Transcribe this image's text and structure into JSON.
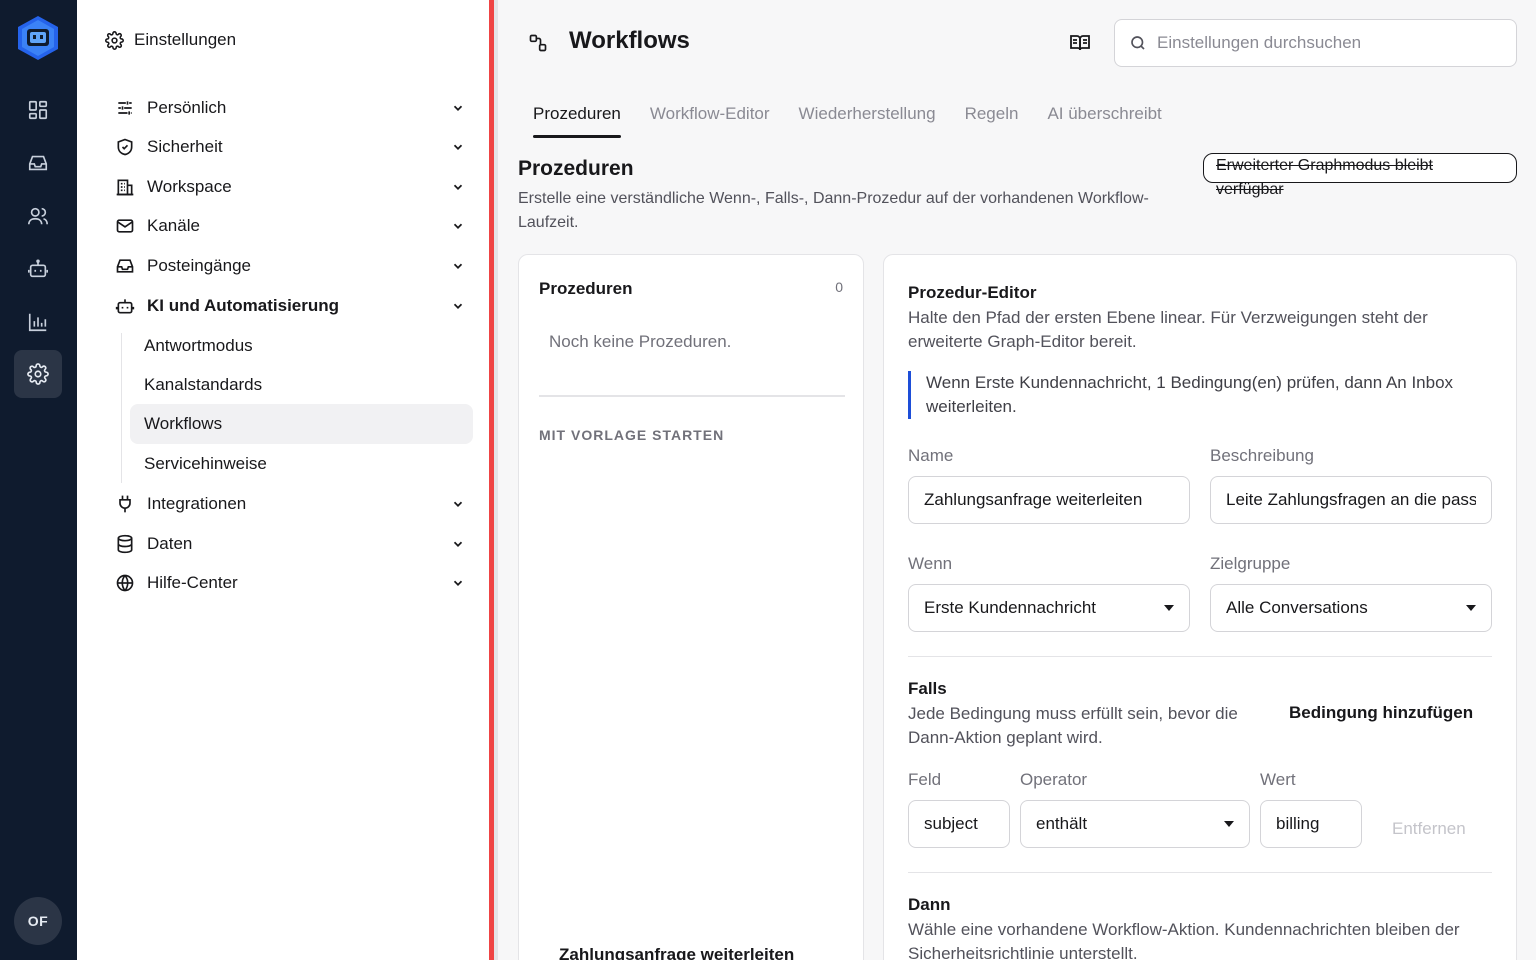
{
  "rail": {
    "avatar_initials": "OF",
    "items": [
      {
        "icon": "dashboard-icon"
      },
      {
        "icon": "inbox-icon"
      },
      {
        "icon": "users-icon"
      },
      {
        "icon": "bot-icon"
      },
      {
        "icon": "bar-chart-icon"
      },
      {
        "icon": "gear-icon",
        "active": true
      }
    ]
  },
  "sidebar": {
    "title": "Einstellungen",
    "items": [
      {
        "label": "Persönlich",
        "icon": "sliders-icon"
      },
      {
        "label": "Sicherheit",
        "icon": "shield-icon"
      },
      {
        "label": "Workspace",
        "icon": "building-icon"
      },
      {
        "label": "Kanäle",
        "icon": "mail-icon"
      },
      {
        "label": "Posteingänge",
        "icon": "inbox-icon"
      },
      {
        "label": "KI und Automatisierung",
        "icon": "bot-icon",
        "expanded": true
      },
      {
        "label": "Integrationen",
        "icon": "plug-icon"
      },
      {
        "label": "Daten",
        "icon": "database-icon"
      },
      {
        "label": "Hilfe-Center",
        "icon": "globe-icon"
      }
    ],
    "subitems": [
      "Antwortmodus",
      "Kanalstandards",
      "Workflows",
      "Servicehinweise"
    ],
    "active_subitem": "Workflows"
  },
  "header": {
    "title": "Workflows",
    "search_placeholder": "Einstellungen durchsuchen"
  },
  "tabs": [
    "Prozeduren",
    "Workflow-Editor",
    "Wiederherstellung",
    "Regeln",
    "AI überschreibt"
  ],
  "active_tab": "Prozeduren",
  "section": {
    "title": "Prozeduren",
    "description": "Erstelle eine verständliche Wenn-, Falls-, Dann-Prozedur auf der vorhandenen Workflow-Laufzeit.",
    "graph_mode_button": "Erweiterter Graphmodus bleibt verfügbar"
  },
  "list_card": {
    "title": "Prozeduren",
    "count": "0",
    "empty_text": "Noch keine Prozeduren.",
    "templates_heading": "MIT VORLAGE STARTEN",
    "template_item": "Zahlungsanfrage weiterleiten"
  },
  "editor": {
    "title": "Prozedur-Editor",
    "description": "Halte den Pfad der ersten Ebene linear. Für Verzweigungen steht der erweiterte Graph-Editor bereit.",
    "summary": "Wenn Erste Kundennachricht, 1 Bedingung(en) prüfen, dann An Inbox weiterleiten.",
    "name_label": "Name",
    "name_value": "Zahlungsanfrage weiterleiten",
    "desc_label": "Beschreibung",
    "desc_value": "Leite Zahlungsfragen an die passende Inbox weiter",
    "when_label": "Wenn",
    "when_value": "Erste Kundennachricht",
    "audience_label": "Zielgruppe",
    "audience_value": "Alle Conversations",
    "if_title": "Falls",
    "if_desc": "Jede Bedingung muss erfüllt sein, bevor die Dann-Aktion geplant wird.",
    "add_condition": "Bedingung hinzufügen",
    "field_label": "Feld",
    "operator_label": "Operator",
    "value_label": "Wert",
    "field_value": "subject",
    "operator_value": "enthält",
    "value_value": "billing",
    "remove": "Entfernen",
    "then_title": "Dann",
    "then_desc": "Wähle eine vorhandene Workflow-Aktion. Kundennachrichten bleiben der Sicherheitsrichtlinie unterstellt."
  },
  "colors": {
    "rail_bg": "#0f1b2e",
    "accent_blue": "#1d4ed8",
    "divider_red": "#ef4444"
  }
}
